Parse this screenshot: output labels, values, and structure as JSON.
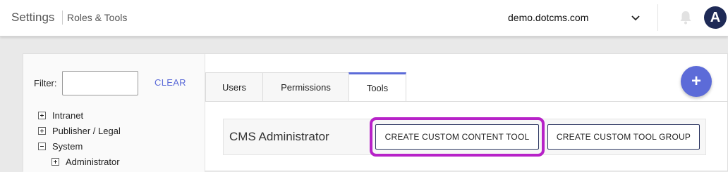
{
  "header": {
    "title": "Settings",
    "breadcrumb": "Roles & Tools",
    "site": "demo.dotcms.com",
    "avatar_letter": "A"
  },
  "filter": {
    "label": "Filter:",
    "value": "",
    "clear_label": "CLEAR"
  },
  "tree": [
    {
      "label": "Intranet",
      "state": "collapsed"
    },
    {
      "label": "Publisher / Legal",
      "state": "collapsed"
    },
    {
      "label": "System",
      "state": "expanded"
    },
    {
      "label": "Administrator",
      "state": "collapsed"
    }
  ],
  "tabs": [
    {
      "label": "Users"
    },
    {
      "label": "Permissions"
    },
    {
      "label": "Tools",
      "active": true
    }
  ],
  "fab": {
    "label": "+"
  },
  "role_tools": {
    "role_name": "CMS Administrator",
    "create_tool_label": "CREATE CUSTOM CONTENT TOOL",
    "create_group_label": "CREATE CUSTOM TOOL GROUP"
  },
  "colors": {
    "accent": "#5c6bd8",
    "highlight": "#b722c8",
    "avatar": "#1e2a56"
  }
}
